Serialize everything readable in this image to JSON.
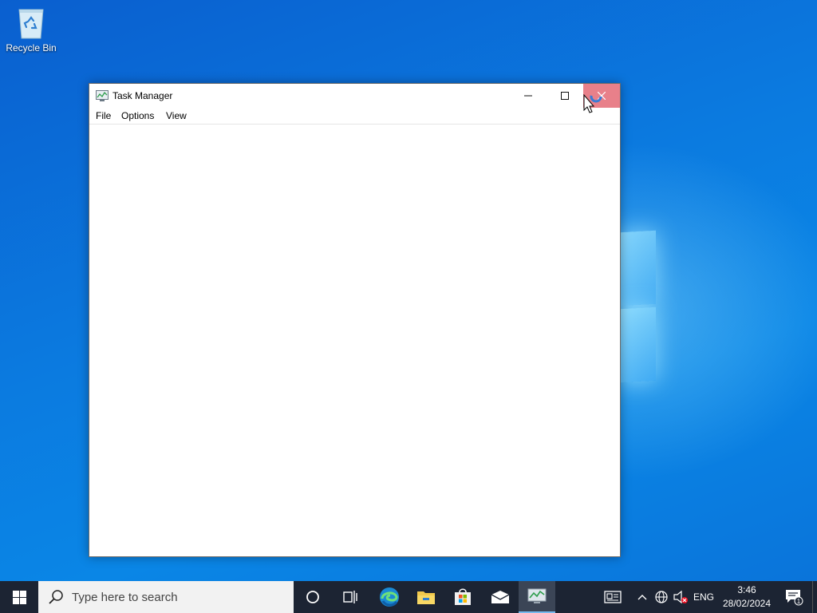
{
  "desktop": {
    "icons": [
      {
        "label": "Recycle Bin",
        "icon": "recycle-bin-icon"
      }
    ]
  },
  "window": {
    "title": "Task Manager",
    "icon": "task-manager-icon",
    "controls": {
      "minimize": "minimize-icon",
      "maximize": "maximize-icon",
      "close": "close-icon"
    },
    "menu": [
      "File",
      "Options",
      "View"
    ]
  },
  "taskbar": {
    "start_icon": "windows-start-icon",
    "search": {
      "placeholder": "Type here to search",
      "icon": "search-icon"
    },
    "apps": [
      {
        "name": "cortana",
        "icon": "cortana-icon",
        "active": false
      },
      {
        "name": "task-view",
        "icon": "task-view-icon",
        "active": false
      },
      {
        "name": "edge",
        "icon": "edge-icon",
        "active": false
      },
      {
        "name": "file-explorer",
        "icon": "folder-icon",
        "active": false
      },
      {
        "name": "store",
        "icon": "store-icon",
        "active": false
      },
      {
        "name": "mail",
        "icon": "mail-icon",
        "active": false
      },
      {
        "name": "task-manager",
        "icon": "task-manager-icon",
        "active": true
      }
    ],
    "tray": {
      "language": "ENG",
      "time": "3:46",
      "date": "28/02/2024",
      "notification_count": "1"
    }
  },
  "colors": {
    "close_hover": "#e8808a",
    "taskbar": "#1c2433",
    "search_box": "#f2f2f2",
    "desktop_blue": "#0a74da"
  }
}
